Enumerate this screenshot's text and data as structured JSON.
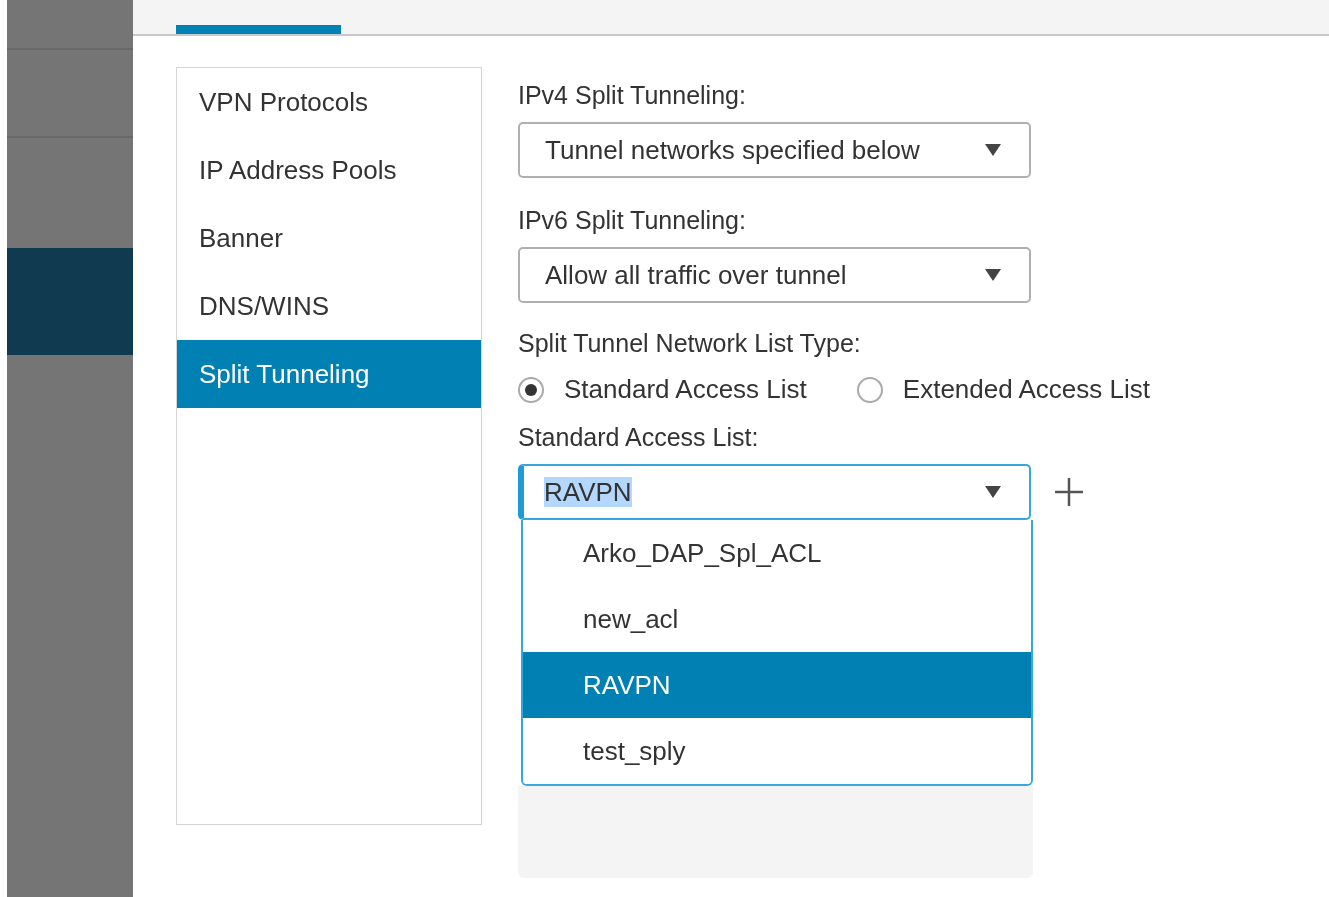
{
  "rail": {
    "items": [
      {
        "selected": false
      },
      {
        "selected": false
      },
      {
        "selected": false
      },
      {
        "selected": true
      },
      {
        "selected": false
      }
    ]
  },
  "header_tabs": [
    {
      "selected": true
    }
  ],
  "nav": {
    "items": [
      {
        "label": "VPN Protocols",
        "selected": false
      },
      {
        "label": "IP Address Pools",
        "selected": false
      },
      {
        "label": "Banner",
        "selected": false
      },
      {
        "label": "DNS/WINS",
        "selected": false
      },
      {
        "label": "Split Tunneling",
        "selected": true
      }
    ]
  },
  "form": {
    "ipv4": {
      "label": "IPv4 Split Tunneling:",
      "value": "Tunnel networks specified below"
    },
    "ipv6": {
      "label": "IPv6 Split Tunneling:",
      "value": "Allow all traffic over tunnel"
    },
    "list_type": {
      "label": "Split Tunnel Network List Type:",
      "options": [
        {
          "label": "Standard Access List",
          "selected": true
        },
        {
          "label": "Extended Access List",
          "selected": false
        }
      ]
    },
    "access_list": {
      "label": "Standard Access List:",
      "value": "RAVPN",
      "value_highlighted": true,
      "expanded": true,
      "options": [
        {
          "label": "Arko_DAP_Spl_ACL",
          "selected": false
        },
        {
          "label": "new_acl",
          "selected": false
        },
        {
          "label": "RAVPN",
          "selected": true
        },
        {
          "label": "test_sply",
          "selected": false
        }
      ]
    }
  }
}
